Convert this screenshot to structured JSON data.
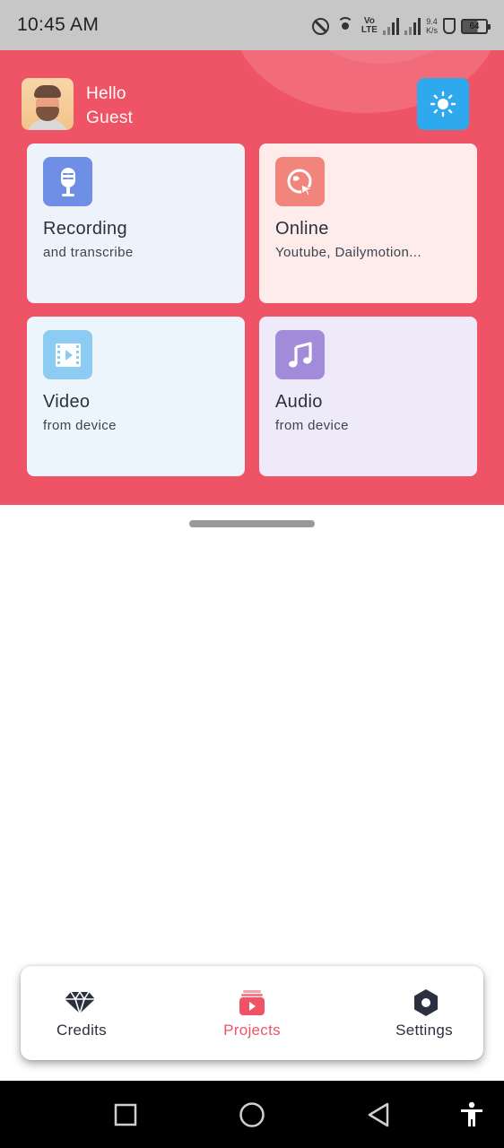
{
  "status_bar": {
    "time": "10:45 AM",
    "speed_top": "9.4",
    "speed_bottom": "K/s",
    "volte_top": "Vo",
    "volte_bottom": "LTE",
    "battery": "64",
    "icons": [
      "dnd-icon",
      "wifi-icon",
      "volte-icon",
      "signal-icon",
      "signal-icon",
      "speed-indicator",
      "flask-icon",
      "battery-icon"
    ]
  },
  "header": {
    "greeting": "Hello",
    "user_name": "Guest",
    "theme_icon": "sun-icon"
  },
  "cards": [
    {
      "title": "Recording",
      "subtitle": "and transcribe",
      "icon": "microphone-icon",
      "icon_color": "#6f8ee6",
      "bg": "#edf2fb"
    },
    {
      "title": "Online",
      "subtitle": "Youtube, Dailymotion...",
      "icon": "globe-cursor-icon",
      "icon_color": "#f1857b",
      "bg": "#fdecea"
    },
    {
      "title": "Video",
      "subtitle": "from device",
      "icon": "video-file-icon",
      "icon_color": "#8ccbf2",
      "bg": "#ecf4fc"
    },
    {
      "title": "Audio",
      "subtitle": "from device",
      "icon": "music-note-icon",
      "icon_color": "#a28bd8",
      "bg": "#efeafa"
    }
  ],
  "bottom_nav": {
    "items": [
      {
        "label": "Credits",
        "icon": "diamond-icon",
        "active": false
      },
      {
        "label": "Projects",
        "icon": "projects-icon",
        "active": true
      },
      {
        "label": "Settings",
        "icon": "hexagon-settings-icon",
        "active": false
      }
    ]
  },
  "colors": {
    "accent": "#ef5366",
    "theme_button": "#2fa9ee",
    "text_dark": "#2b3040"
  }
}
